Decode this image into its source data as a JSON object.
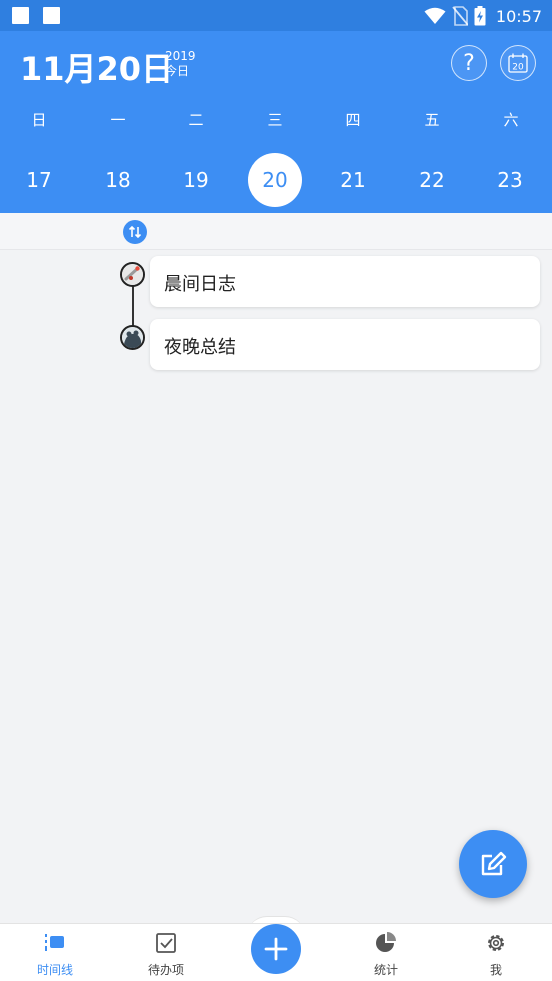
{
  "statusbar": {
    "time": "10:57"
  },
  "header": {
    "date": "11月20日",
    "year": "2019",
    "today_label": "今日",
    "help_label": "?",
    "calendar_day": "20"
  },
  "weekdays": [
    "日",
    "一",
    "二",
    "三",
    "四",
    "五",
    "六"
  ],
  "days": [
    {
      "label": "17",
      "selected": false
    },
    {
      "label": "18",
      "selected": false
    },
    {
      "label": "19",
      "selected": false
    },
    {
      "label": "20",
      "selected": true
    },
    {
      "label": "21",
      "selected": false
    },
    {
      "label": "22",
      "selected": false
    },
    {
      "label": "23",
      "selected": false
    }
  ],
  "timeline": [
    {
      "title": "晨间日志",
      "icon": "morning-icon"
    },
    {
      "title": "夜晚总结",
      "icon": "night-icon"
    }
  ],
  "bottom_nav": [
    {
      "label": "时间线",
      "icon": "timeline-icon",
      "active": true
    },
    {
      "label": "待办项",
      "icon": "todo-checkbox-icon",
      "active": false
    },
    {
      "label": "统计",
      "icon": "pie-chart-icon",
      "active": false
    },
    {
      "label": "我",
      "icon": "gear-icon",
      "active": false
    }
  ],
  "colors": {
    "primary": "#3d8ef3",
    "statusbar": "#2f7fe0",
    "background": "#f2f3f5"
  }
}
